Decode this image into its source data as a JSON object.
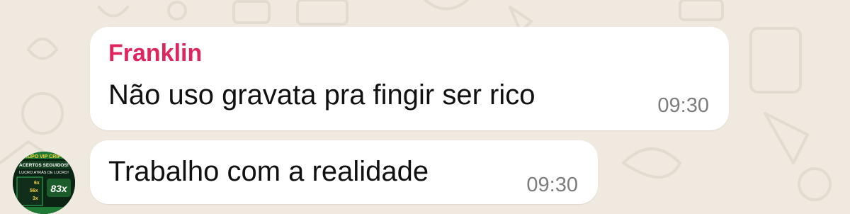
{
  "messages": [
    {
      "sender": "Franklin",
      "text": "Não uso gravata pra fingir ser rico",
      "time": "09:30"
    },
    {
      "text": "Trabalho com a realidade",
      "time": "09:30"
    }
  ],
  "avatar": {
    "texts": [
      "ACERTOS SEGUIDOS!",
      "LUCRO ATRÁS DE LUCRO!",
      "GRUPO VIP CRIPTO",
      "6x",
      "56x",
      "3x",
      "83x"
    ]
  },
  "theme": {
    "sender_color": "#e0245e",
    "bubble_color": "#ffffff",
    "background": "#efe9df",
    "time_color": "#7d7d7d"
  }
}
